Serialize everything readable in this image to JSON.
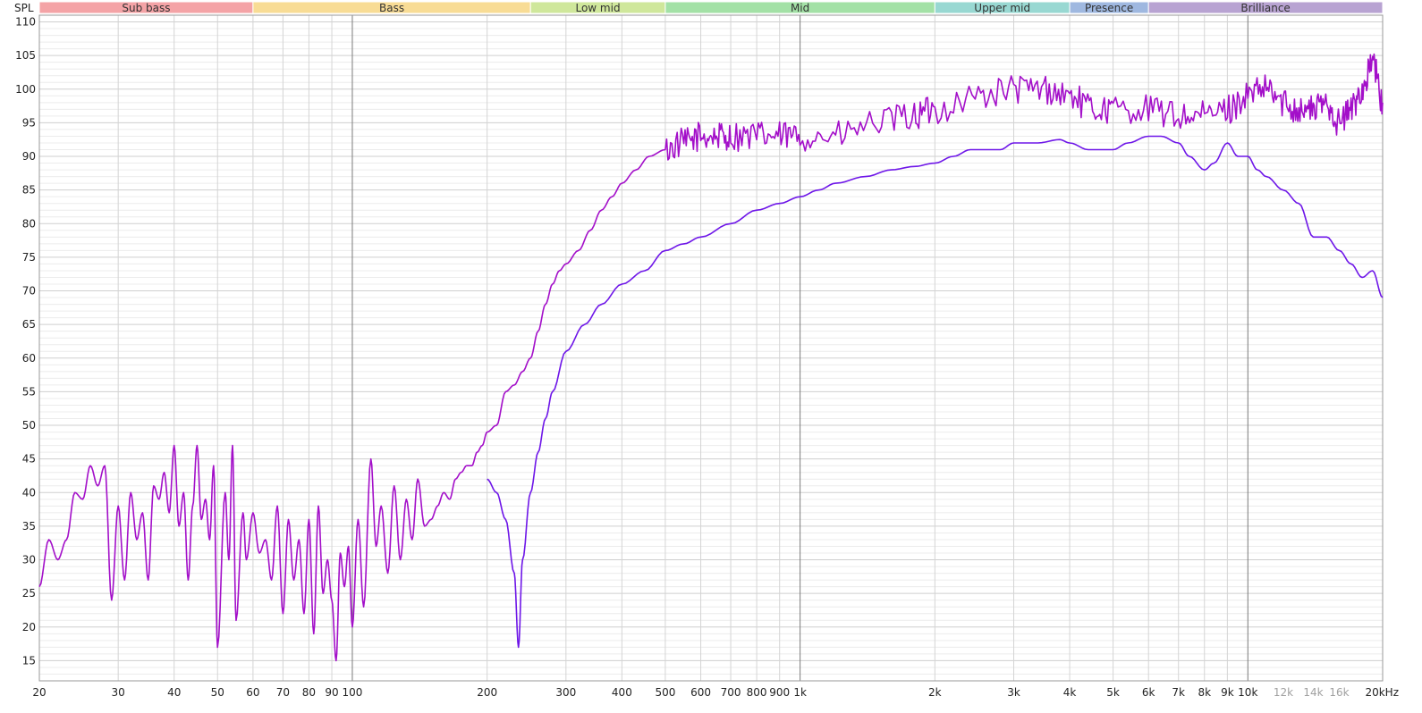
{
  "chart_data": {
    "type": "line",
    "y_axis_label": "SPL",
    "x_unit": "kHz",
    "x_scale": "log",
    "xlim": [
      20,
      20000
    ],
    "ylim": [
      12,
      111
    ],
    "grid": true,
    "y_ticks": [
      110,
      105,
      100,
      95,
      90,
      85,
      80,
      75,
      70,
      65,
      60,
      55,
      50,
      45,
      40,
      35,
      30,
      25,
      20,
      15
    ],
    "x_ticks": [
      {
        "value": 20,
        "label": "20"
      },
      {
        "value": 30,
        "label": "30"
      },
      {
        "value": 40,
        "label": "40"
      },
      {
        "value": 50,
        "label": "50"
      },
      {
        "value": 60,
        "label": "60"
      },
      {
        "value": 70,
        "label": "70"
      },
      {
        "value": 80,
        "label": "80"
      },
      {
        "value": 90,
        "label": "90"
      },
      {
        "value": 100,
        "label": "100"
      },
      {
        "value": 200,
        "label": "200"
      },
      {
        "value": 300,
        "label": "300"
      },
      {
        "value": 400,
        "label": "400"
      },
      {
        "value": 500,
        "label": "500"
      },
      {
        "value": 600,
        "label": "600"
      },
      {
        "value": 700,
        "label": "700"
      },
      {
        "value": 800,
        "label": "800"
      },
      {
        "value": 900,
        "label": "900"
      },
      {
        "value": 1000,
        "label": "1k"
      },
      {
        "value": 2000,
        "label": "2k"
      },
      {
        "value": 3000,
        "label": "3k"
      },
      {
        "value": 4000,
        "label": "4k"
      },
      {
        "value": 5000,
        "label": "5k"
      },
      {
        "value": 6000,
        "label": "6k"
      },
      {
        "value": 7000,
        "label": "7k"
      },
      {
        "value": 8000,
        "label": "8k"
      },
      {
        "value": 9000,
        "label": "9k"
      },
      {
        "value": 10000,
        "label": "10k"
      },
      {
        "value": 12000,
        "label": "12k",
        "minor": true
      },
      {
        "value": 14000,
        "label": "14k",
        "minor": true
      },
      {
        "value": 16000,
        "label": "16k",
        "minor": true
      },
      {
        "value": 20000,
        "label": "20kHz"
      }
    ],
    "bands": [
      {
        "name": "Sub bass",
        "from": 20,
        "to": 60,
        "color": "#f4a3a6"
      },
      {
        "name": "Bass",
        "from": 60,
        "to": 250,
        "color": "#f8dc95"
      },
      {
        "name": "Low mid",
        "from": 250,
        "to": 500,
        "color": "#cfe79b"
      },
      {
        "name": "Mid",
        "from": 500,
        "to": 2000,
        "color": "#a3e1a6"
      },
      {
        "name": "Upper mid",
        "from": 2000,
        "to": 4000,
        "color": "#98d8d2"
      },
      {
        "name": "Presence",
        "from": 4000,
        "to": 6000,
        "color": "#9fb8e0"
      },
      {
        "name": "Brilliance",
        "from": 6000,
        "to": 20000,
        "color": "#b8a3d2"
      }
    ],
    "series": [
      {
        "color": "#a30fc9",
        "noise_from": 500,
        "x": [
          20,
          21,
          22,
          23,
          24,
          25,
          26,
          27,
          28,
          29,
          30,
          31,
          32,
          33,
          34,
          35,
          36,
          37,
          38,
          39,
          40,
          41,
          42,
          43,
          44,
          45,
          46,
          47,
          48,
          49,
          50,
          52,
          53,
          54,
          55,
          57,
          58,
          60,
          62,
          64,
          66,
          68,
          70,
          72,
          74,
          76,
          78,
          80,
          82,
          84,
          86,
          88,
          90,
          92,
          94,
          96,
          98,
          100,
          103,
          106,
          110,
          113,
          116,
          120,
          124,
          128,
          132,
          136,
          140,
          145,
          150,
          155,
          160,
          165,
          170,
          175,
          180,
          185,
          190,
          195,
          200,
          210,
          220,
          230,
          240,
          250,
          260,
          270,
          280,
          290,
          300,
          320,
          340,
          360,
          380,
          400,
          430,
          460,
          500,
          550,
          600,
          650,
          700,
          800,
          900,
          1000,
          1200,
          1500,
          1800,
          2000,
          2500,
          3000,
          3500,
          4000,
          4500,
          5000,
          6000,
          7000,
          8000,
          9000,
          10000,
          11000,
          12000,
          13000,
          14000,
          15000,
          16000,
          17000,
          18000,
          19000,
          20000
        ],
        "values": [
          26,
          33,
          30,
          33,
          40,
          39,
          44,
          41,
          44,
          24,
          38,
          27,
          40,
          33,
          37,
          27,
          41,
          39,
          43,
          37,
          47,
          35,
          40,
          27,
          38,
          47,
          36,
          39,
          33,
          44,
          17,
          40,
          30,
          47,
          21,
          37,
          30,
          37,
          31,
          33,
          27,
          38,
          22,
          36,
          27,
          33,
          22,
          36,
          19,
          38,
          25,
          30,
          24,
          15,
          31,
          26,
          32,
          20,
          36,
          23,
          45,
          32,
          38,
          28,
          41,
          30,
          39,
          33,
          42,
          35,
          36,
          38,
          40,
          39,
          42,
          43,
          44,
          44,
          46,
          47,
          49,
          50,
          55,
          56,
          58,
          60,
          64,
          68,
          71,
          73,
          74,
          76,
          79,
          82,
          84,
          86,
          88,
          90,
          91,
          92,
          93,
          93,
          93,
          93,
          93,
          93,
          93,
          95,
          96,
          97,
          99,
          100,
          100,
          99,
          97,
          97,
          97,
          96,
          96,
          97,
          99,
          100,
          98,
          97,
          97,
          98,
          95,
          97,
          100,
          104,
          98
        ]
      },
      {
        "color": "#6e16e8",
        "noise_from": 999999,
        "x": [
          200,
          210,
          220,
          230,
          235,
          240,
          250,
          260,
          270,
          280,
          300,
          330,
          360,
          400,
          450,
          500,
          550,
          600,
          700,
          800,
          900,
          1000,
          1100,
          1200,
          1400,
          1600,
          1800,
          2000,
          2200,
          2400,
          2800,
          3000,
          3400,
          3800,
          4000,
          4400,
          4800,
          5000,
          5400,
          6000,
          6400,
          7000,
          7400,
          8000,
          8400,
          9000,
          9500,
          10000,
          10500,
          11000,
          12000,
          13000,
          14000,
          15000,
          16000,
          17000,
          18000,
          19000,
          20000
        ],
        "values": [
          42,
          40,
          36,
          28,
          17,
          30,
          40,
          46,
          51,
          55,
          61,
          65,
          68,
          71,
          73,
          76,
          77,
          78,
          80,
          82,
          83,
          84,
          85,
          86,
          87,
          88,
          88.5,
          89,
          90,
          91,
          91,
          92,
          92,
          92.5,
          92,
          91,
          91,
          91,
          92,
          93,
          93,
          92,
          90,
          88,
          89,
          92,
          90,
          90,
          88,
          87,
          85,
          83,
          78,
          78,
          76,
          74,
          72,
          73,
          69
        ]
      }
    ]
  }
}
